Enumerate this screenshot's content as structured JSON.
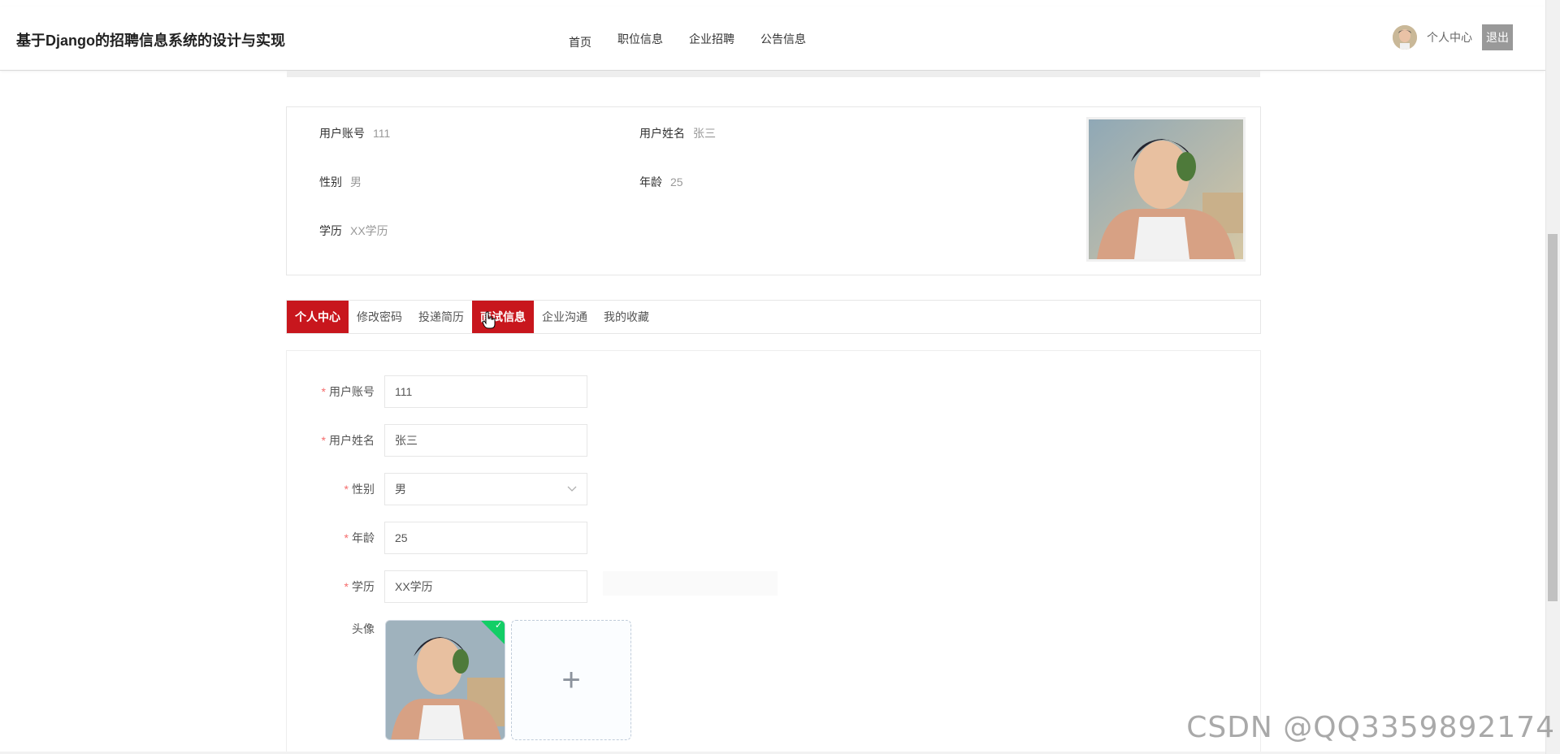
{
  "header": {
    "site_title": "基于Django的招聘信息系统的设计与实现",
    "nav": [
      "首页",
      "职位信息",
      "企业招聘",
      "公告信息"
    ],
    "user_center": "个人中心",
    "logout": "退出"
  },
  "profile": {
    "account_label": "用户账号",
    "account_value": "111",
    "name_label": "用户姓名",
    "name_value": "张三",
    "gender_label": "性别",
    "gender_value": "男",
    "age_label": "年龄",
    "age_value": "25",
    "education_label": "学历",
    "education_value": "XX学历"
  },
  "tabs": [
    "个人中心",
    "修改密码",
    "投递简历",
    "面试信息",
    "企业沟通",
    "我的收藏"
  ],
  "form": {
    "required_mark": "*",
    "fields": [
      {
        "label": "用户账号",
        "value": "111"
      },
      {
        "label": "用户姓名",
        "value": "张三"
      },
      {
        "label": "性别",
        "value": "男"
      },
      {
        "label": "年龄",
        "value": "25"
      },
      {
        "label": "学历",
        "value": "XX学历"
      }
    ],
    "avatar_label": "头像",
    "check_icon": "✓",
    "add_icon": "+"
  },
  "watermark": "CSDN @QQ3359892174"
}
